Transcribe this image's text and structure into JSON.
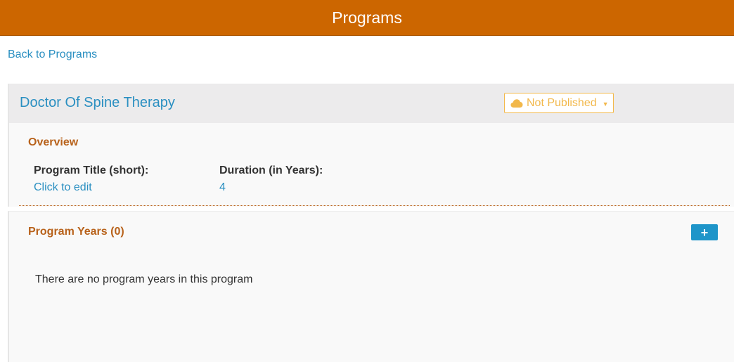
{
  "header": {
    "title": "Programs"
  },
  "nav": {
    "back_label": "Back to Programs"
  },
  "program": {
    "title": "Doctor Of Spine Therapy",
    "publish_status": "Not Published"
  },
  "overview": {
    "heading": "Overview",
    "fields": [
      {
        "label": "Program Title (short):",
        "value": "Click to edit"
      },
      {
        "label": "Duration (in Years):",
        "value": "4"
      }
    ]
  },
  "program_years": {
    "heading": "Program Years (0)",
    "empty_message": "There are no program years in this program",
    "add_icon": "plus-icon"
  },
  "colors": {
    "brand": "#cc6600",
    "link": "#2a8fc1",
    "section_heading": "#b8621b",
    "warning": "#f2b84b",
    "button": "#1e95c9"
  }
}
